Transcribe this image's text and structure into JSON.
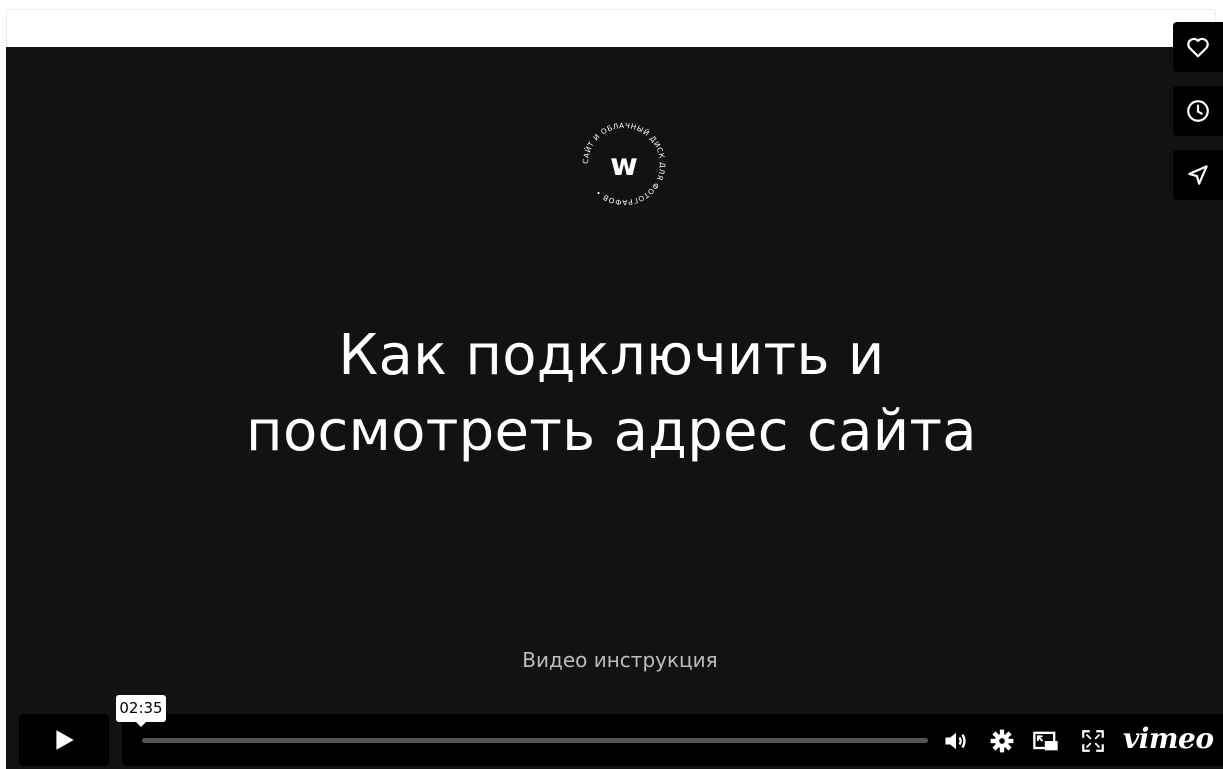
{
  "player": {
    "title_line1": "Как подключить и",
    "title_line2": "посмотреть адрес сайта",
    "subtitle": "Видео инструкция",
    "logo_letter": "w",
    "logo_ring_text": "САЙТ И ОБЛАЧНЫЙ ДИСК ДЛЯ ФОТОГРАФОВ • ",
    "hover_time": "02:35",
    "brand": "vimeo",
    "progress_fraction": 0.0
  },
  "side_buttons": [
    {
      "name": "like-button",
      "icon": "heart-icon"
    },
    {
      "name": "watch-later-button",
      "icon": "clock-icon"
    },
    {
      "name": "share-button",
      "icon": "paper-plane-icon"
    }
  ],
  "colors": {
    "video_bg": "#121212",
    "controls_bg": "#000000",
    "text_primary": "#ffffff",
    "text_secondary": "#bdbdbd"
  }
}
